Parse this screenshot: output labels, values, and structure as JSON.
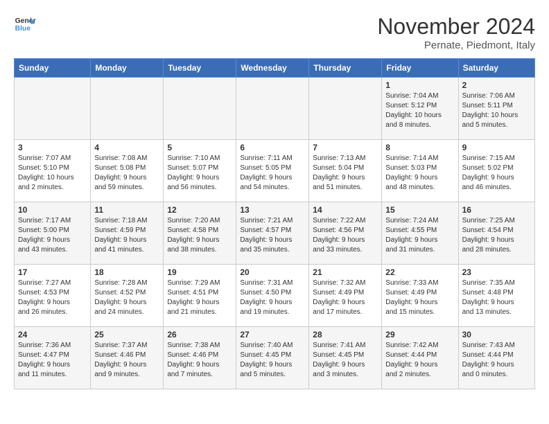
{
  "logo": {
    "line1": "General",
    "line2": "Blue"
  },
  "title": "November 2024",
  "location": "Pernate, Piedmont, Italy",
  "weekdays": [
    "Sunday",
    "Monday",
    "Tuesday",
    "Wednesday",
    "Thursday",
    "Friday",
    "Saturday"
  ],
  "weeks": [
    [
      {
        "day": "",
        "info": ""
      },
      {
        "day": "",
        "info": ""
      },
      {
        "day": "",
        "info": ""
      },
      {
        "day": "",
        "info": ""
      },
      {
        "day": "",
        "info": ""
      },
      {
        "day": "1",
        "info": "Sunrise: 7:04 AM\nSunset: 5:12 PM\nDaylight: 10 hours\nand 8 minutes."
      },
      {
        "day": "2",
        "info": "Sunrise: 7:06 AM\nSunset: 5:11 PM\nDaylight: 10 hours\nand 5 minutes."
      }
    ],
    [
      {
        "day": "3",
        "info": "Sunrise: 7:07 AM\nSunset: 5:10 PM\nDaylight: 10 hours\nand 2 minutes."
      },
      {
        "day": "4",
        "info": "Sunrise: 7:08 AM\nSunset: 5:08 PM\nDaylight: 9 hours\nand 59 minutes."
      },
      {
        "day": "5",
        "info": "Sunrise: 7:10 AM\nSunset: 5:07 PM\nDaylight: 9 hours\nand 56 minutes."
      },
      {
        "day": "6",
        "info": "Sunrise: 7:11 AM\nSunset: 5:05 PM\nDaylight: 9 hours\nand 54 minutes."
      },
      {
        "day": "7",
        "info": "Sunrise: 7:13 AM\nSunset: 5:04 PM\nDaylight: 9 hours\nand 51 minutes."
      },
      {
        "day": "8",
        "info": "Sunrise: 7:14 AM\nSunset: 5:03 PM\nDaylight: 9 hours\nand 48 minutes."
      },
      {
        "day": "9",
        "info": "Sunrise: 7:15 AM\nSunset: 5:02 PM\nDaylight: 9 hours\nand 46 minutes."
      }
    ],
    [
      {
        "day": "10",
        "info": "Sunrise: 7:17 AM\nSunset: 5:00 PM\nDaylight: 9 hours\nand 43 minutes."
      },
      {
        "day": "11",
        "info": "Sunrise: 7:18 AM\nSunset: 4:59 PM\nDaylight: 9 hours\nand 41 minutes."
      },
      {
        "day": "12",
        "info": "Sunrise: 7:20 AM\nSunset: 4:58 PM\nDaylight: 9 hours\nand 38 minutes."
      },
      {
        "day": "13",
        "info": "Sunrise: 7:21 AM\nSunset: 4:57 PM\nDaylight: 9 hours\nand 35 minutes."
      },
      {
        "day": "14",
        "info": "Sunrise: 7:22 AM\nSunset: 4:56 PM\nDaylight: 9 hours\nand 33 minutes."
      },
      {
        "day": "15",
        "info": "Sunrise: 7:24 AM\nSunset: 4:55 PM\nDaylight: 9 hours\nand 31 minutes."
      },
      {
        "day": "16",
        "info": "Sunrise: 7:25 AM\nSunset: 4:54 PM\nDaylight: 9 hours\nand 28 minutes."
      }
    ],
    [
      {
        "day": "17",
        "info": "Sunrise: 7:27 AM\nSunset: 4:53 PM\nDaylight: 9 hours\nand 26 minutes."
      },
      {
        "day": "18",
        "info": "Sunrise: 7:28 AM\nSunset: 4:52 PM\nDaylight: 9 hours\nand 24 minutes."
      },
      {
        "day": "19",
        "info": "Sunrise: 7:29 AM\nSunset: 4:51 PM\nDaylight: 9 hours\nand 21 minutes."
      },
      {
        "day": "20",
        "info": "Sunrise: 7:31 AM\nSunset: 4:50 PM\nDaylight: 9 hours\nand 19 minutes."
      },
      {
        "day": "21",
        "info": "Sunrise: 7:32 AM\nSunset: 4:49 PM\nDaylight: 9 hours\nand 17 minutes."
      },
      {
        "day": "22",
        "info": "Sunrise: 7:33 AM\nSunset: 4:49 PM\nDaylight: 9 hours\nand 15 minutes."
      },
      {
        "day": "23",
        "info": "Sunrise: 7:35 AM\nSunset: 4:48 PM\nDaylight: 9 hours\nand 13 minutes."
      }
    ],
    [
      {
        "day": "24",
        "info": "Sunrise: 7:36 AM\nSunset: 4:47 PM\nDaylight: 9 hours\nand 11 minutes."
      },
      {
        "day": "25",
        "info": "Sunrise: 7:37 AM\nSunset: 4:46 PM\nDaylight: 9 hours\nand 9 minutes."
      },
      {
        "day": "26",
        "info": "Sunrise: 7:38 AM\nSunset: 4:46 PM\nDaylight: 9 hours\nand 7 minutes."
      },
      {
        "day": "27",
        "info": "Sunrise: 7:40 AM\nSunset: 4:45 PM\nDaylight: 9 hours\nand 5 minutes."
      },
      {
        "day": "28",
        "info": "Sunrise: 7:41 AM\nSunset: 4:45 PM\nDaylight: 9 hours\nand 3 minutes."
      },
      {
        "day": "29",
        "info": "Sunrise: 7:42 AM\nSunset: 4:44 PM\nDaylight: 9 hours\nand 2 minutes."
      },
      {
        "day": "30",
        "info": "Sunrise: 7:43 AM\nSunset: 4:44 PM\nDaylight: 9 hours\nand 0 minutes."
      }
    ]
  ]
}
